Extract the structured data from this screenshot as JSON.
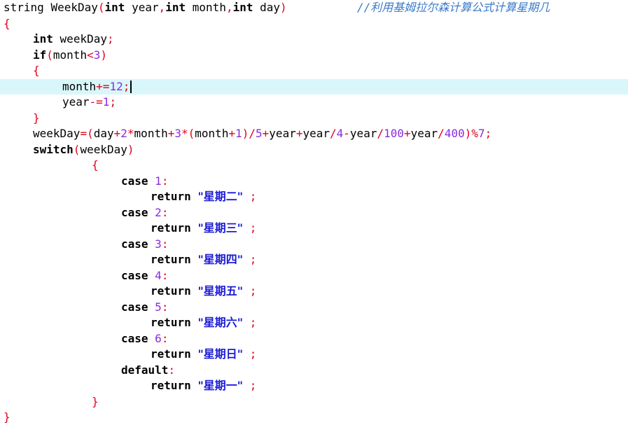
{
  "window": {
    "title": ""
  },
  "editor": {
    "current_line": 5,
    "t": {
      "string": "string",
      "WeekDay": "WeekDay",
      "int": "int",
      "year": "year",
      "month": "month",
      "day": "day",
      "weekDay": "weekDay",
      "if": "if",
      "switch": "switch",
      "case": "case",
      "return": "return",
      "default": "default",
      "lparen": "(",
      "rparen": ")",
      "comma": ",",
      "semi": ";",
      "colon": ":",
      "lbrace": "{",
      "rbrace": "}",
      "lt": "<",
      "plus_eq": "+=",
      "minus_eq": "-=",
      "eq": "=",
      "plus": "+",
      "minus": "-",
      "mul": "*",
      "div": "/",
      "mod": "%",
      "space": " "
    },
    "n": {
      "n1": "1",
      "n2": "2",
      "n3": "3",
      "n4": "4",
      "n5": "5",
      "n6": "6",
      "n7": "7",
      "n12": "12",
      "n100": "100",
      "n400": "400"
    },
    "strings": {
      "tue": "\"星期二\"",
      "wed": "\"星期三\"",
      "thu": "\"星期四\"",
      "fri": "\"星期五\"",
      "sat": "\"星期六\"",
      "sun": "\"星期日\"",
      "mon": "\"星期一\""
    },
    "comment": "//利用基姆拉尔森计算公式计算星期几"
  },
  "colors": {
    "keyword": "#000000",
    "operator": "#e0001b",
    "number": "#8a2be2",
    "string": "#1a1ad6",
    "comment": "#3a7ac8",
    "current_line_bg": "#d9f7fb"
  }
}
